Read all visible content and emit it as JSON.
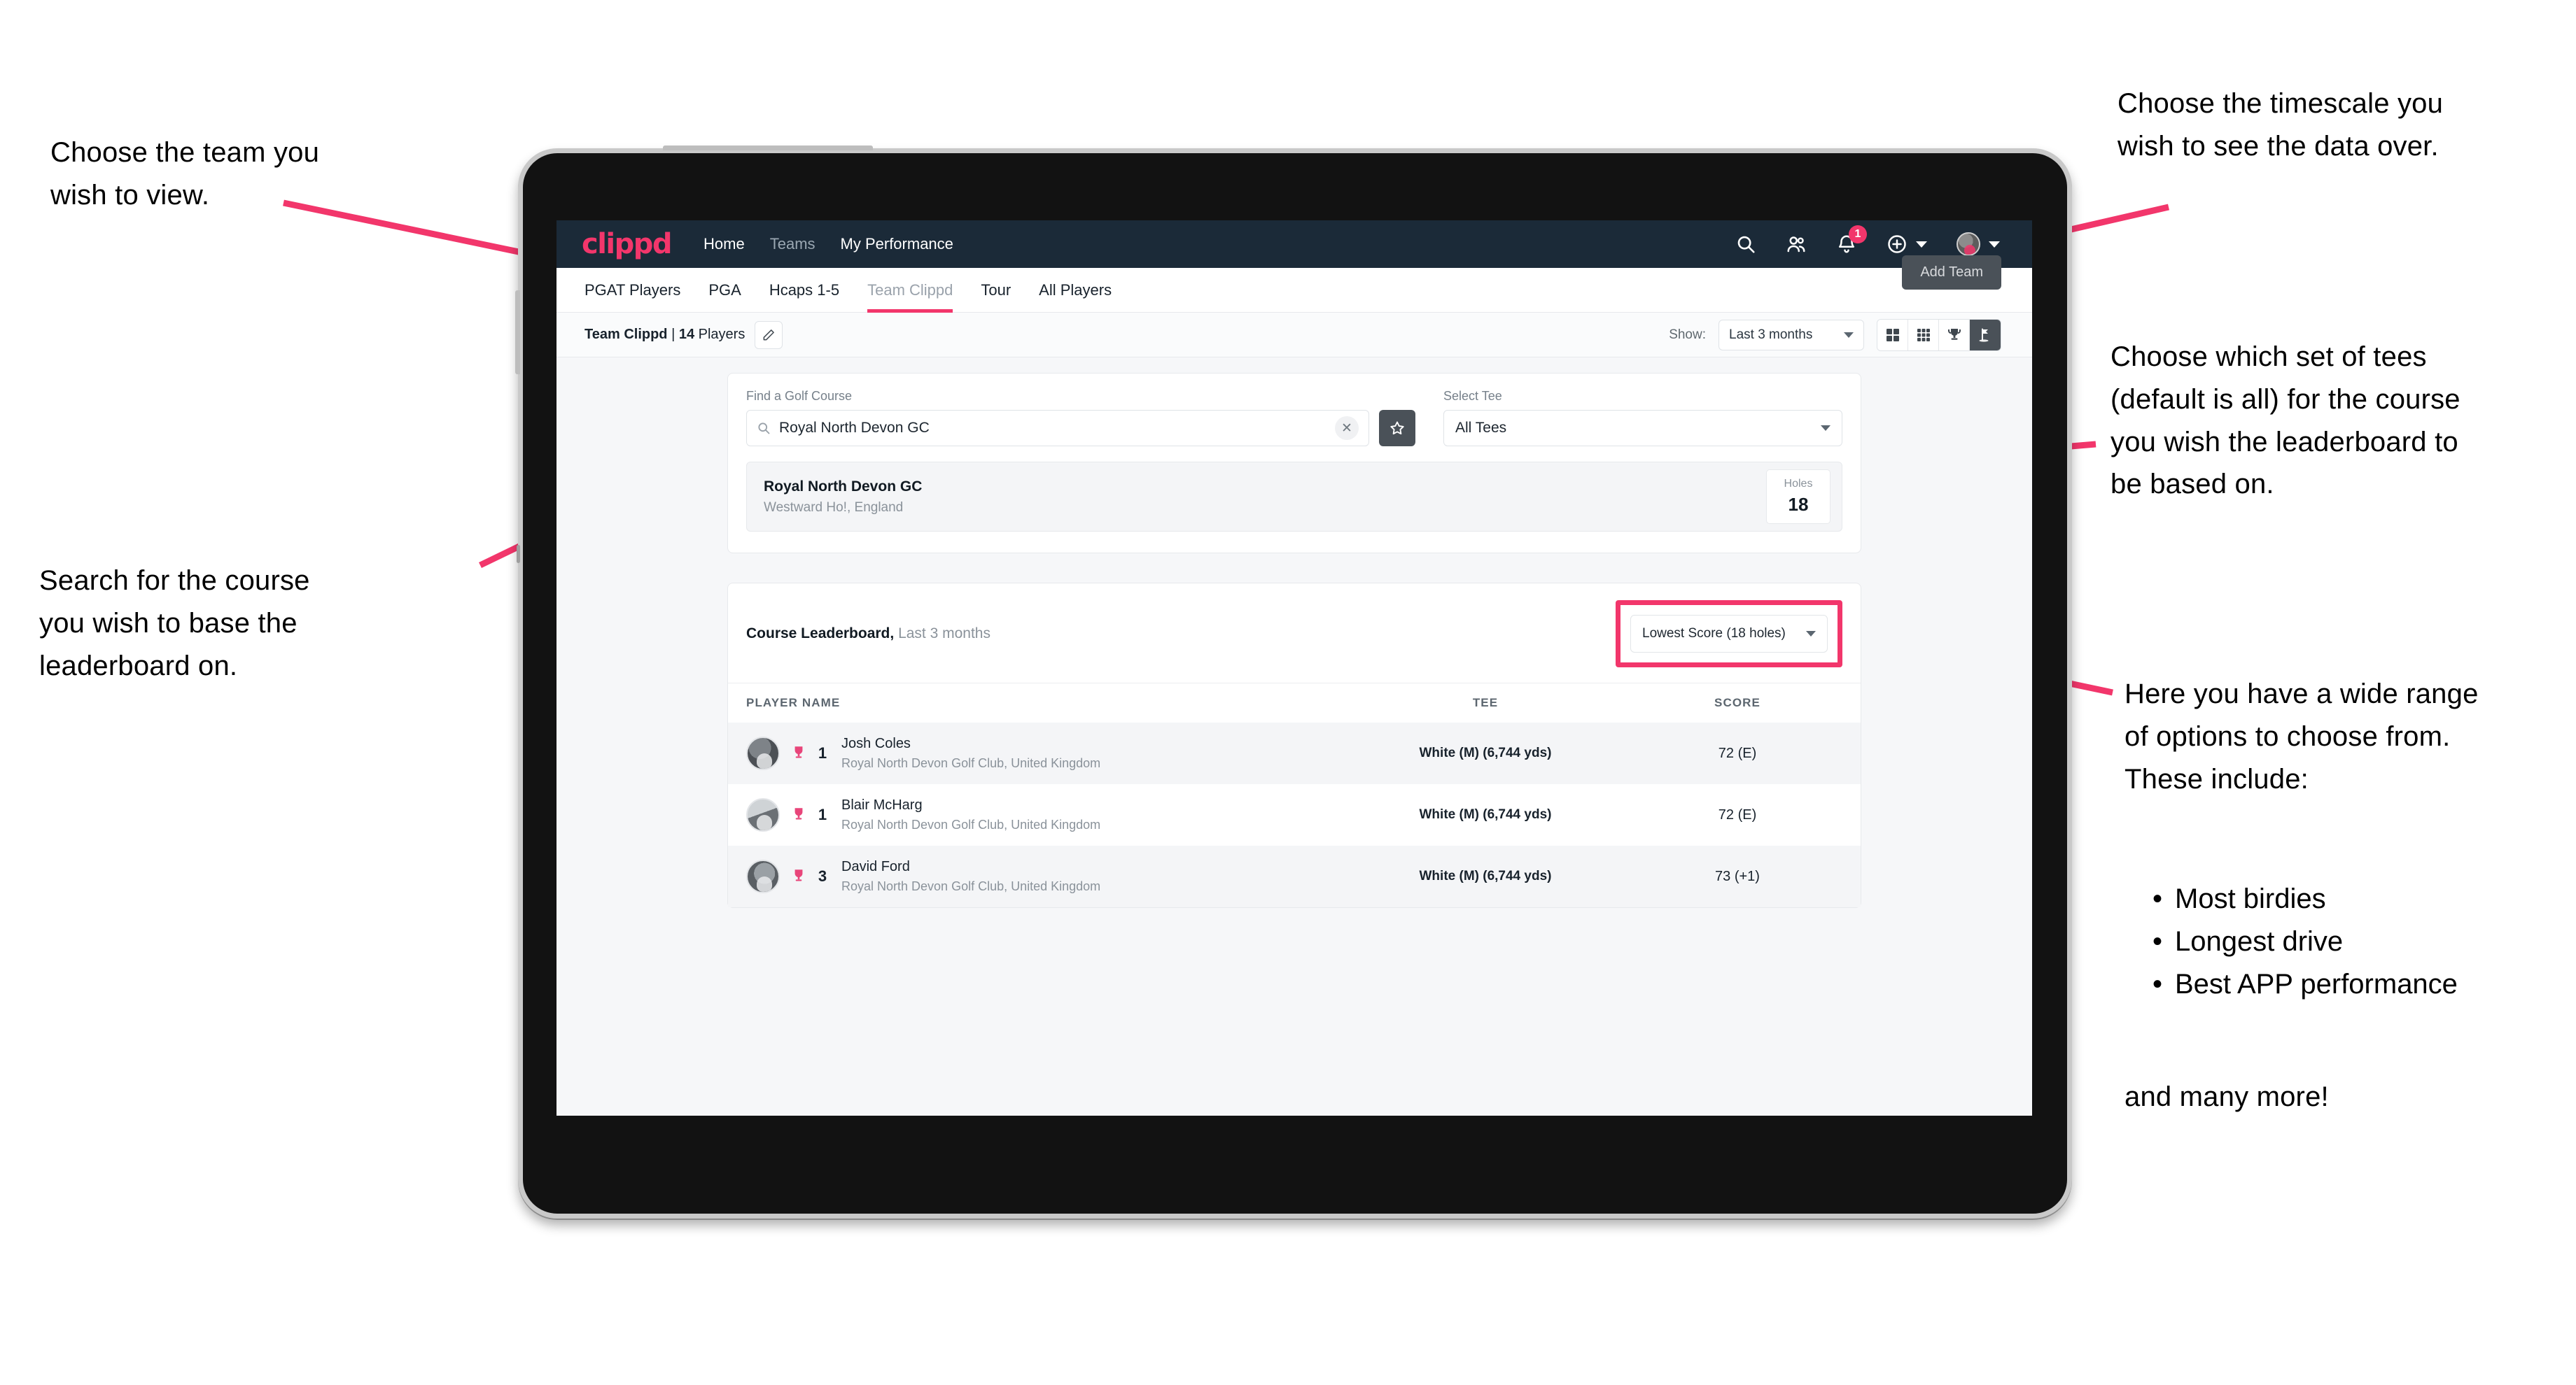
{
  "annotations": {
    "team": "Choose the team you\nwish to view.",
    "search": "Search for the course\nyou wish to base the\nleaderboard on.",
    "timescale": "Choose the timescale you\nwish to see the data over.",
    "tees": "Choose which set of tees\n(default is all) for the course\nyou wish the leaderboard to\nbe based on.",
    "options_intro": "Here you have a wide range\nof options to choose from.\nThese include:",
    "options_bullets": [
      "Most birdies",
      "Longest drive",
      "Best APP performance"
    ],
    "options_outro": "and many more!"
  },
  "navbar": {
    "logo": "clippd",
    "links": [
      {
        "label": "Home",
        "muted": false
      },
      {
        "label": "Teams",
        "muted": true
      },
      {
        "label": "My Performance",
        "muted": false
      }
    ],
    "icons": [
      "search-icon",
      "people-icon",
      "bell-icon",
      "plus-circle-icon",
      "avatar-icon"
    ],
    "notification_count": "1"
  },
  "tabs": [
    {
      "label": "PGAT Players",
      "active": false,
      "muted": false
    },
    {
      "label": "PGA",
      "active": false,
      "muted": false
    },
    {
      "label": "Hcaps 1-5",
      "active": false,
      "muted": false
    },
    {
      "label": "Team Clippd",
      "active": true,
      "muted": true
    },
    {
      "label": "Tour",
      "active": false,
      "muted": false
    },
    {
      "label": "All Players",
      "active": false,
      "muted": false
    }
  ],
  "add_team_button": "Add Team",
  "toolbar": {
    "team_name": "Team Clippd",
    "separator": " | ",
    "player_count": "14",
    "players_label": " Players",
    "edit_icon": "pencil-icon",
    "show_label": "Show:",
    "show_value": "Last 3 months",
    "view_toggles": [
      {
        "icon": "grid-large-icon",
        "active": false
      },
      {
        "icon": "grid-small-icon",
        "active": false
      },
      {
        "icon": "trophy-icon",
        "active": false
      },
      {
        "icon": "golf-flag-icon",
        "active": true
      }
    ]
  },
  "search_panel": {
    "course_field_label": "Find a Golf Course",
    "course_value": "Royal North Devon GC",
    "course_placeholder": "Find a Golf Course",
    "clear_icon": "close-icon",
    "favourite_icon": "star-icon",
    "tee_field_label": "Select Tee",
    "tee_value": "All Tees"
  },
  "course_result": {
    "name": "Royal North Devon GC",
    "location": "Westward Ho!, England",
    "holes_label": "Holes",
    "holes_value": "18"
  },
  "leaderboard": {
    "title": "Course Leaderboard,",
    "subtitle": " Last 3 months",
    "sort_value": "Lowest Score (18 holes)",
    "columns": [
      "PLAYER NAME",
      "TEE",
      "SCORE"
    ],
    "rows": [
      {
        "rank": "1",
        "name": "Josh Coles",
        "club": "Royal North Devon Golf Club, United Kingdom",
        "tee": "White (M) (6,744 yds)",
        "score": "72 (E)"
      },
      {
        "rank": "1",
        "name": "Blair McHarg",
        "club": "Royal North Devon Golf Club, United Kingdom",
        "tee": "White (M) (6,744 yds)",
        "score": "72 (E)"
      },
      {
        "rank": "3",
        "name": "David Ford",
        "club": "Royal North Devon Golf Club, United Kingdom",
        "tee": "White (M) (6,744 yds)",
        "score": "73 (+1)"
      }
    ]
  },
  "colors": {
    "accent_pink": "#f2366b",
    "navbar_dark": "#1b2a38",
    "button_dark": "#4a5158",
    "page_bg": "#f6f7f9"
  }
}
